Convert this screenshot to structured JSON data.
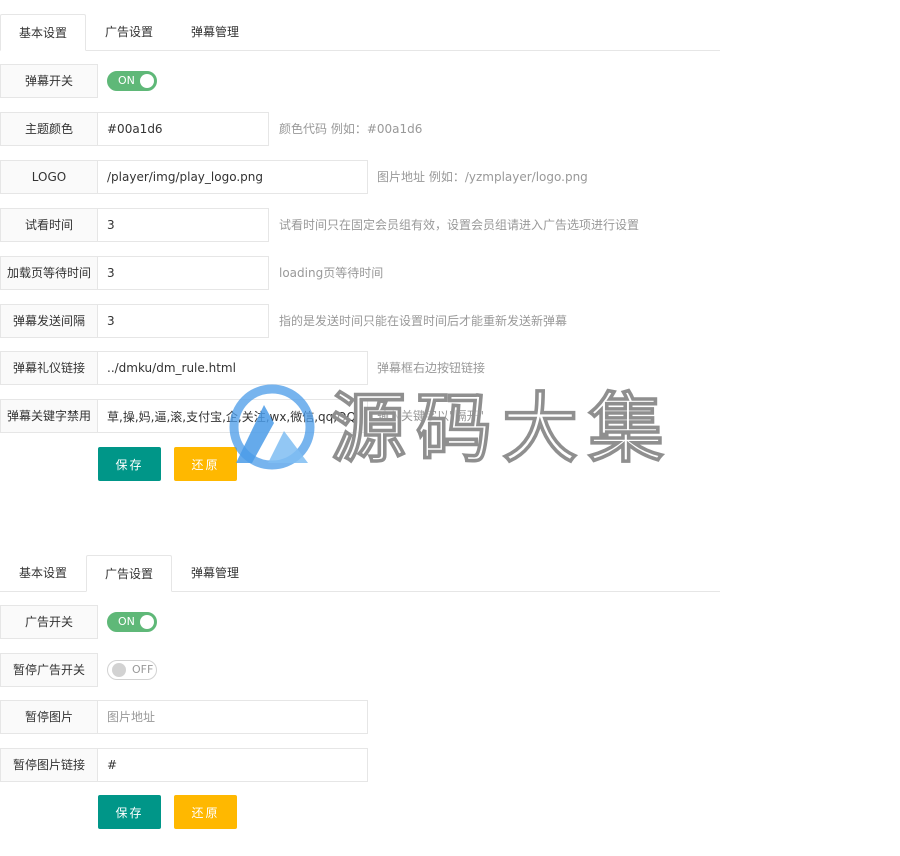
{
  "panel1": {
    "tabs": [
      "基本设置",
      "广告设置",
      "弹幕管理"
    ],
    "active_tab": 0,
    "rows": {
      "danmu_switch": {
        "label": "弹幕开关",
        "state": "ON"
      },
      "theme_color": {
        "label": "主题颜色",
        "value": "#00a1d6",
        "hint": "颜色代码 例如：#00a1d6"
      },
      "logo": {
        "label": "LOGO",
        "value": "/player/img/play_logo.png",
        "hint": "图片地址 例如：/yzmplayer/logo.png"
      },
      "trial_time": {
        "label": "试看时间",
        "value": "3",
        "hint": "试看时间只在固定会员组有效，设置会员组请进入广告选项进行设置"
      },
      "loading_wait": {
        "label": "加载页等待时间",
        "value": "3",
        "hint": "loading页等待时间"
      },
      "send_interval": {
        "label": "弹幕发送间隔",
        "value": "3",
        "hint": "指的是发送时间只能在设置时间后才能重新发送新弹幕"
      },
      "etiquette_link": {
        "label": "弹幕礼仪链接",
        "value": "../dmku/dm_rule.html",
        "hint": "弹幕框右边按钮链接"
      },
      "keyword_ban": {
        "label": "弹幕关键字禁用",
        "value": "草,操,妈,逼,滚,支付宝,企,关注,wx,微信,qq,QQ",
        "hint": "输入关键字以\"隔开\""
      }
    },
    "buttons": {
      "save": "保存",
      "reset": "还原"
    }
  },
  "panel2": {
    "tabs": [
      "基本设置",
      "广告设置",
      "弹幕管理"
    ],
    "active_tab": 1,
    "rows": {
      "ad_switch": {
        "label": "广告开关",
        "state": "ON"
      },
      "pause_ad_switch": {
        "label": "暂停广告开关",
        "state": "OFF"
      },
      "pause_image": {
        "label": "暂停图片",
        "value": "",
        "placeholder": "图片地址"
      },
      "pause_image_link": {
        "label": "暂停图片链接",
        "value": "#"
      }
    },
    "buttons": {
      "save": "保存",
      "reset": "还原"
    }
  },
  "watermark": {
    "text": "源码大集"
  },
  "colors": {
    "switch_on": "#5fb878",
    "save_button": "#009688",
    "reset_button": "#ffb800",
    "border": "#e6e6e6",
    "hint_text": "#999999"
  }
}
